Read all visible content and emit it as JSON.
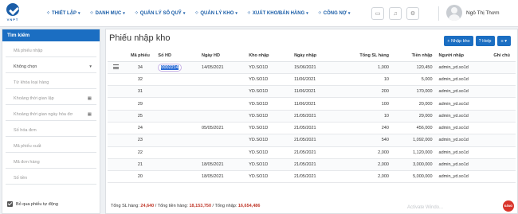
{
  "logo": {
    "text": "VNPT"
  },
  "nav": [
    {
      "label": "THIẾT LẬP",
      "icon": "grid-icon"
    },
    {
      "label": "DANH MỤC",
      "icon": "grid-icon"
    },
    {
      "label": "QUẢN LÝ SỔ QUỸ",
      "icon": "grid-icon"
    },
    {
      "label": "QUẢN LÝ KHO",
      "icon": "grid-icon"
    },
    {
      "label": "XUẤT KHO/BÁN HÀNG",
      "icon": "grid-icon"
    },
    {
      "label": "CÔNG NỢ",
      "icon": "grid-icon"
    }
  ],
  "user": {
    "name": "Ngô Thị Thơm"
  },
  "sidebar": {
    "title": "Tìm kiếm",
    "fields": [
      {
        "placeholder": "Mã phiếu nhập",
        "type": "text"
      },
      {
        "value": "Không chọn",
        "type": "select"
      },
      {
        "placeholder": "Từ khóa loại hàng",
        "type": "text"
      },
      {
        "placeholder": "Khoảng thời gian lập",
        "type": "date"
      },
      {
        "placeholder": "Khoảng thời gian ngày hóa đơ",
        "type": "date"
      },
      {
        "placeholder": "Số hóa đơn",
        "type": "text"
      },
      {
        "placeholder": "Mã phiếu xuất",
        "type": "text"
      },
      {
        "placeholder": "Mã đơn hàng",
        "type": "text"
      },
      {
        "placeholder": "Số tiền",
        "type": "text"
      }
    ],
    "checkbox_label": "Bỏ qua phiếu tự động"
  },
  "main": {
    "title": "Phiếu nhập kho",
    "buttons": {
      "add": "+ Nhập kho",
      "help": "? Help",
      "list": "≡ ▾"
    },
    "columns": [
      "Mã phiếu",
      "Số HD",
      "Ngày HD",
      "Kho nhập",
      "Ngày nhập",
      "Tổng SL hàng",
      "Tiền nhập",
      "Người nhập",
      "Ghi chú"
    ],
    "rows": [
      {
        "ma": "34",
        "hd": "0002214",
        "ngay_hd": "14/05/2021",
        "kho": "YD.SO1D",
        "ngay_nhap": "15/06/2021",
        "sl": "1,000",
        "tien": "120,450",
        "nguoi": "admin_yd.so1d"
      },
      {
        "ma": "32",
        "hd": "",
        "ngay_hd": "",
        "kho": "YD.SO1D",
        "ngay_nhap": "11/06/2021",
        "sl": "10",
        "tien": "5,000",
        "nguoi": "admin_yd.so1d"
      },
      {
        "ma": "31",
        "hd": "",
        "ngay_hd": "",
        "kho": "YD.SO1D",
        "ngay_nhap": "11/06/2021",
        "sl": "200",
        "tien": "170,000",
        "nguoi": "admin_yd.so1d"
      },
      {
        "ma": "29",
        "hd": "",
        "ngay_hd": "",
        "kho": "YD.SO1D",
        "ngay_nhap": "11/06/2021",
        "sl": "100",
        "tien": "20,000",
        "nguoi": "admin_yd.so1d"
      },
      {
        "ma": "25",
        "hd": "",
        "ngay_hd": "",
        "kho": "YD.SO1D",
        "ngay_nhap": "21/05/2021",
        "sl": "10",
        "tien": "29,000",
        "nguoi": "admin_yd.so1d"
      },
      {
        "ma": "24",
        "hd": "",
        "ngay_hd": "05/05/2021",
        "kho": "YD.SO1D",
        "ngay_nhap": "21/05/2021",
        "sl": "240",
        "tien": "456,000",
        "nguoi": "admin_yd.so1d"
      },
      {
        "ma": "23",
        "hd": "",
        "ngay_hd": "",
        "kho": "YD.SO1D",
        "ngay_nhap": "21/05/2021",
        "sl": "540",
        "tien": "1,092,000",
        "nguoi": "admin_yd.so1d"
      },
      {
        "ma": "22",
        "hd": "",
        "ngay_hd": "",
        "kho": "YD.SO1D",
        "ngay_nhap": "21/05/2021",
        "sl": "2,000",
        "tien": "1,120,000",
        "nguoi": "admin_yd.so1d"
      },
      {
        "ma": "21",
        "hd": "",
        "ngay_hd": "18/05/2021",
        "kho": "YD.SO1D",
        "ngay_nhap": "21/05/2021",
        "sl": "2,000",
        "tien": "3,000,000",
        "nguoi": "admin_yd.so1d"
      },
      {
        "ma": "20",
        "hd": "",
        "ngay_hd": "18/05/2021",
        "kho": "YD.SO1D",
        "ngay_nhap": "21/05/2021",
        "sl": "2,000",
        "tien": "5,000,000",
        "nguoi": "admin_yd.so1d"
      }
    ],
    "footer": {
      "sl_label": "Tổng SL hàng: ",
      "sl_value": "24,640",
      "tien_label": " / Tổng tiền hàng: ",
      "tien_value": "18,153,750",
      "nhap_label": " / Tổng nhập: ",
      "nhap_value": "16,654,486"
    }
  },
  "watermark": "Activate Windo...",
  "badge": "ĐĂNG KÝ",
  "colors": {
    "primary": "#1b6ec2",
    "brand": "#1b5ea8",
    "total_value": "#c0392b"
  }
}
